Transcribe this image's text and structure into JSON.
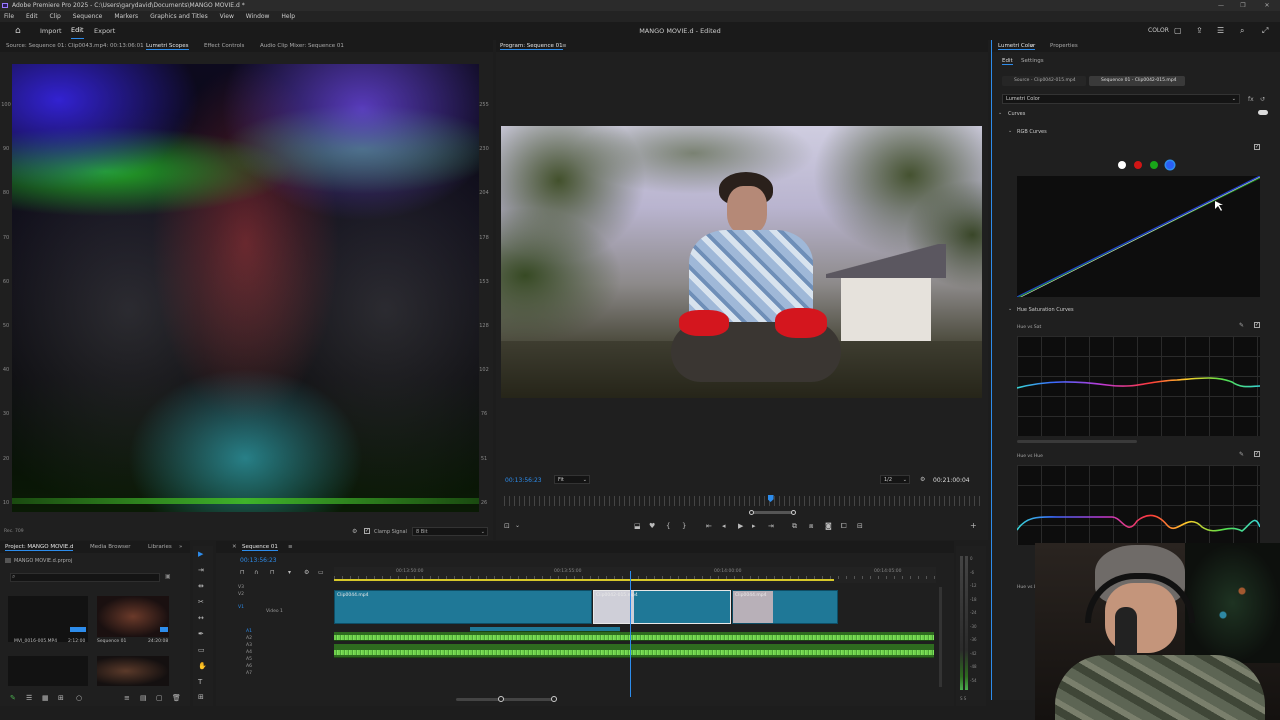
{
  "app": {
    "title": "Adobe Premiere Pro 2025 - C:\\Users\\garydavid\\Documents\\MANGO MOVIE.d *",
    "project_title": "MANGO MOVIE.d - Edited"
  },
  "menu": [
    "File",
    "Edit",
    "Clip",
    "Sequence",
    "Markers",
    "Graphics and Titles",
    "View",
    "Window",
    "Help"
  ],
  "toolbar": {
    "home_label": "",
    "import_label": "Import",
    "edit_label": "Edit",
    "export_label": "Export",
    "workspace_label": "COLOR"
  },
  "source_panel": {
    "tabs": [
      "Source: Sequence 01: Clip0043.mp4: 00:13:06:01",
      "Lumetri Scopes",
      "Effect Controls",
      "Audio Clip Mixer: Sequence 01"
    ],
    "left_scale": [
      "100",
      "90",
      "80",
      "70",
      "60",
      "50",
      "40",
      "30",
      "20",
      "10",
      "0"
    ],
    "right_scale": [
      "255",
      "230",
      "204",
      "178",
      "153",
      "128",
      "102",
      "76",
      "51",
      "26",
      "0"
    ],
    "footer_left": "Rec. 709",
    "clamp_label": "Clamp Signal",
    "bit_depth": "8 Bit"
  },
  "program_panel": {
    "tab": "Program: Sequence 01",
    "timecode": "00:13:56:23",
    "fit_label": "Fit",
    "resolution": "1/2",
    "duration": "00:21:00:04",
    "playhead_fraction": 0.56
  },
  "lumetri": {
    "tabs": [
      "Lumetri Color",
      "Properties"
    ],
    "subtabs": [
      "Edit",
      "Settings"
    ],
    "source_label": "Source - Clip0042-015.mp4",
    "sequence_label": "Sequence 01 - Clip0042-015.mp4",
    "effect_select": "Lumetri Color",
    "curves_label": "Curves",
    "rgb_curves_label": "RGB Curves",
    "hue_sat_curves_label": "Hue Saturation Curves",
    "hue_vs_sat_label": "Hue vs Sat",
    "hue_vs_hue_label": "Hue vs Hue",
    "hue_vs_luma_label": "Hue vs L",
    "channel_colors": [
      "#ffffff",
      "#d01515",
      "#19a519",
      "#2a5ff5"
    ]
  },
  "project_panel": {
    "tabs": [
      "Project: MANGO MOVIE.d",
      "Media Browser",
      "Libraries"
    ],
    "file_name": "MANGO MOVIE.d.prproj",
    "items": [
      {
        "name": "MVI_0016-005.MP4",
        "duration": "2:12:00"
      },
      {
        "name": "Sequence 01",
        "duration": "24:20:08"
      }
    ]
  },
  "timeline": {
    "tab": "Sequence 01",
    "timecode": "00:13:56:23",
    "ruler": [
      "00:13:50:00",
      "00:13:55:00",
      "00:14:00:00",
      "00:14:05:00"
    ],
    "tracks": {
      "video": [
        "V3",
        "V2",
        "V1"
      ],
      "video_label": "Video 1",
      "audio": [
        "A1",
        "A2",
        "A3",
        "A4",
        "A5",
        "A6",
        "A7"
      ]
    },
    "clips": [
      {
        "name": "Clip0044.mp4"
      },
      {
        "name": "Clip0042-015.mp4"
      },
      {
        "name": "Clip0044.mp4"
      }
    ],
    "meter_labels": [
      "0",
      "-6",
      "-12",
      "-18",
      "-24",
      "-30",
      "-36",
      "-42",
      "-48",
      "-54"
    ],
    "meter_footer": "S S"
  }
}
